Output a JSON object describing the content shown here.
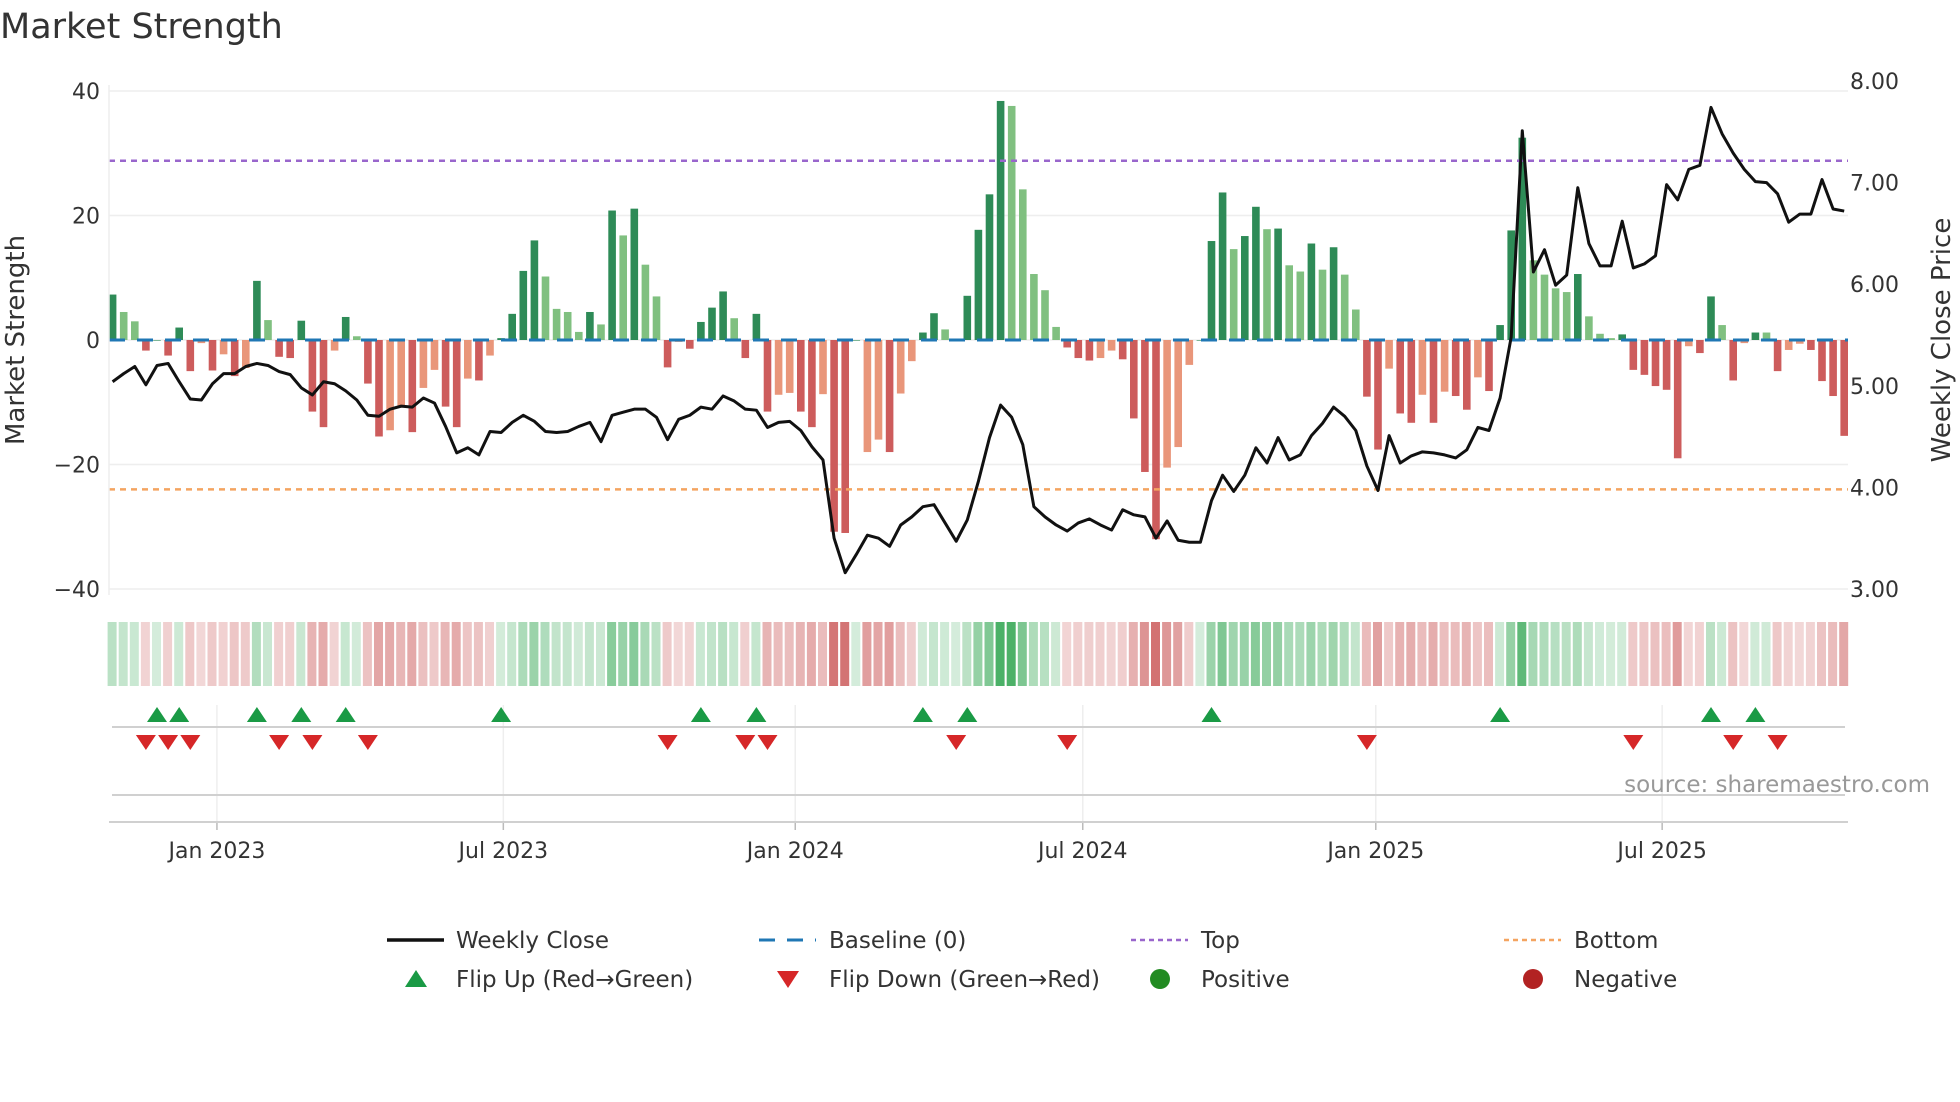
{
  "chart_data": {
    "type": "bar",
    "title": "Market Strength",
    "ylabel": "Market Strength",
    "y2label": "Weekly Close Price",
    "ylim": [
      -40,
      40
    ],
    "y2lim": [
      3.0,
      8.0
    ],
    "yticks": [
      "40",
      "20",
      "0",
      "−20",
      "−40"
    ],
    "ytick_values": [
      40,
      20,
      0,
      -20,
      -40
    ],
    "y2ticks": [
      "8.00",
      "7.00",
      "6.00",
      "5.00",
      "4.00",
      "3.00"
    ],
    "y2tick_values": [
      8,
      7,
      6,
      5,
      4,
      3
    ],
    "xticks": [
      "Jan 2023",
      "Jul 2023",
      "Jan 2024",
      "Jul 2024",
      "Jan 2025",
      "Jul 2025"
    ],
    "xtick_week_index": [
      10.4,
      36.2,
      62.5,
      88.4,
      114.8,
      140.6
    ],
    "top_level": 28.8,
    "bottom_level": -24.0,
    "baseline": 0,
    "strength": [
      7.3,
      4.5,
      3.0,
      -1.7,
      0,
      -2.5,
      2.0,
      -5.0,
      -0.5,
      -4.9,
      -2.3,
      -5.8,
      -4.5,
      9.5,
      3.2,
      -2.7,
      -2.9,
      3.1,
      -11.5,
      -14.0,
      -1.7,
      3.7,
      0.6,
      -7.0,
      -15.5,
      -14.5,
      -10.8,
      -14.8,
      -7.7,
      -4.8,
      -10.7,
      -14.0,
      -6.2,
      -6.5,
      -2.5,
      0.3,
      4.2,
      11.1,
      16.0,
      10.2,
      5.0,
      4.5,
      1.3,
      4.5,
      2.5,
      20.8,
      16.8,
      21.1,
      12.1,
      7.0,
      -4.4,
      -0.3,
      -1.4,
      2.9,
      5.2,
      7.8,
      3.5,
      -2.9,
      4.2,
      -11.5,
      -8.8,
      -8.5,
      -11.5,
      -14.0,
      -8.7,
      -30.8,
      -31.0,
      0,
      -18.0,
      -16.0,
      -18.0,
      -8.6,
      -3.4,
      1.2,
      4.3,
      1.7,
      0,
      7.1,
      17.7,
      23.4,
      38.4,
      37.6,
      24.2,
      10.6,
      8.0,
      2.1,
      -1.2,
      -2.9,
      -3.3,
      -2.9,
      -1.7,
      -3.1,
      -12.6,
      -21.2,
      -32.0,
      -20.5,
      -17.2,
      -4.0,
      0,
      15.9,
      23.7,
      14.6,
      16.7,
      21.4,
      17.8,
      17.9,
      12.0,
      11.0,
      15.5,
      11.3,
      14.9,
      10.5,
      4.9,
      -9.1,
      -17.6,
      -4.6,
      -11.8,
      -13.3,
      -8.8,
      -13.3,
      -8.3,
      -9.0,
      -11.2,
      -6.0,
      -8.2,
      2.4,
      17.6,
      32.5,
      12.8,
      10.5,
      8.3,
      7.7,
      10.6,
      3.8,
      1.0,
      0.3,
      0.9,
      -4.8,
      -5.6,
      -7.4,
      -8.0,
      -19.0,
      -1.0,
      -2.1,
      7.0,
      2.4,
      -6.5,
      -0.5,
      1.2,
      1.2,
      -5.0,
      -1.6,
      -0.6,
      -1.6,
      -6.6,
      -9.0,
      -15.4
    ],
    "strength_shade": "DLLDDDDDLDLDLDLDDDDDLDLDDLLDLLDDLDLDDDDLLLLDLDLDLLDLDDDDLDDDLLDDLDDDLLDLLDDLDDDDDLLLLLDDDLLDDDDLLLDDDLDDLDLLDLDLLDDLDDLDLDDLDDDDLLLLDLLLDDDDDDLDDLDLDLDLLDDDD",
    "weekly_close": [
      5.04,
      5.12,
      5.19,
      5.01,
      5.2,
      5.22,
      5.04,
      4.87,
      4.86,
      5.02,
      5.12,
      5.12,
      5.19,
      5.22,
      5.2,
      5.14,
      5.11,
      4.98,
      4.91,
      5.04,
      5.02,
      4.95,
      4.86,
      4.71,
      4.7,
      4.77,
      4.8,
      4.79,
      4.88,
      4.83,
      4.6,
      4.34,
      4.39,
      4.32,
      4.55,
      4.54,
      4.64,
      4.71,
      4.65,
      4.55,
      4.54,
      4.55,
      4.6,
      4.64,
      4.45,
      4.71,
      4.74,
      4.77,
      4.77,
      4.69,
      4.47,
      4.67,
      4.71,
      4.79,
      4.77,
      4.9,
      4.85,
      4.77,
      4.76,
      4.59,
      4.64,
      4.65,
      4.56,
      4.4,
      4.27,
      3.5,
      3.16,
      3.34,
      3.53,
      3.5,
      3.42,
      3.63,
      3.71,
      3.81,
      3.83,
      3.65,
      3.47,
      3.68,
      4.06,
      4.49,
      4.81,
      4.69,
      4.42,
      3.81,
      3.71,
      3.63,
      3.57,
      3.65,
      3.69,
      3.63,
      3.58,
      3.78,
      3.73,
      3.71,
      3.5,
      3.67,
      3.48,
      3.46,
      3.46,
      3.87,
      4.12,
      3.96,
      4.12,
      4.39,
      4.24,
      4.49,
      4.27,
      4.32,
      4.51,
      4.63,
      4.79,
      4.7,
      4.56,
      4.21,
      3.97,
      4.51,
      4.24,
      4.31,
      4.35,
      4.34,
      4.32,
      4.29,
      4.37,
      4.59,
      4.56,
      4.88,
      5.48,
      7.51,
      6.12,
      6.34,
      5.99,
      6.09,
      6.95,
      6.4,
      6.18,
      6.18,
      6.62,
      6.16,
      6.2,
      6.28,
      6.98,
      6.83,
      7.13,
      7.17,
      7.74,
      7.48,
      7.29,
      7.13,
      7.01,
      7.0,
      6.89,
      6.61,
      6.69,
      6.69,
      7.03,
      6.74,
      6.72
    ],
    "flip_up_weeks": [
      5,
      7,
      14,
      18,
      22,
      36,
      54,
      59,
      74,
      78,
      100,
      126,
      145,
      149
    ],
    "flip_down_weeks": [
      4,
      6,
      8,
      16,
      19,
      24,
      51,
      58,
      60,
      77,
      87,
      114,
      138,
      147,
      151
    ],
    "legend": [
      {
        "label": "Weekly Close",
        "kind": "line"
      },
      {
        "label": "Baseline (0)",
        "kind": "dash"
      },
      {
        "label": "Top",
        "kind": "dot-top"
      },
      {
        "label": "Bottom",
        "kind": "dot-bottom"
      },
      {
        "label": "Flip Up (Red→Green)",
        "kind": "tri-up"
      },
      {
        "label": "Flip Down (Green→Red)",
        "kind": "tri-down"
      },
      {
        "label": "Positive",
        "kind": "circle-pos"
      },
      {
        "label": "Negative",
        "kind": "circle-neg"
      }
    ],
    "legend_placement": "bottom",
    "grid": true,
    "source": "source: sharemaestro.com"
  },
  "colors": {
    "dark_green": "#2e8b57",
    "light_green": "#80c080",
    "red": "#cd5c5c",
    "light_red": "#e9967a",
    "baseline": "#1f77b4",
    "top": "#9966cc",
    "bottom": "#f4a460",
    "price": "#111111",
    "flip_up": "#1a9a45",
    "flip_down": "#d62728",
    "positive": "#228b22",
    "negative": "#b22222"
  }
}
